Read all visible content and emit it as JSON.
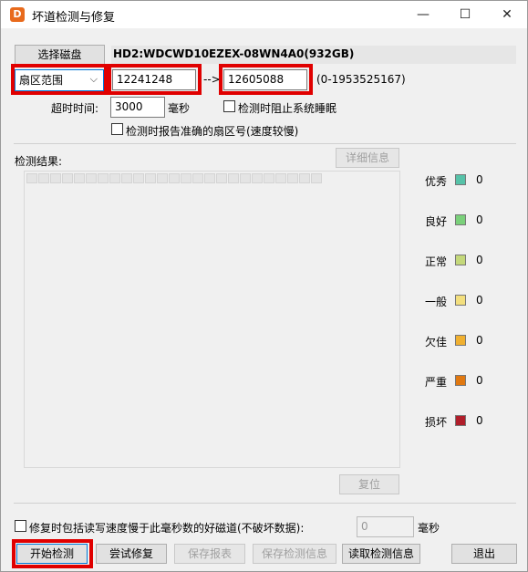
{
  "window": {
    "title": "坏道检测与修复",
    "app_icon_glyph": "D",
    "minimize": "—",
    "maximize": "☐",
    "close": "✕"
  },
  "disk": {
    "select_button": "选择磁盘",
    "name": "HD2:WDCWD10EZEX-08WN4A0(932GB)"
  },
  "range": {
    "mode_selected": "扇区范围",
    "start": "12241248",
    "arrow": "-->",
    "end": "12605088",
    "limit_hint": "(0-1953525167)"
  },
  "timeout": {
    "label": "超时时间:",
    "value": "3000",
    "unit": "毫秒"
  },
  "options": {
    "prevent_sleep": "检测时阻止系统睡眠",
    "report_exact_sector": "检测时报告准确的扇区号(速度较慢)"
  },
  "results": {
    "label": "检测结果:",
    "detail_button": "详细信息",
    "reset_button": "复位",
    "legend": [
      {
        "label": "优秀",
        "count": "0",
        "color": "#56c2a8"
      },
      {
        "label": "良好",
        "count": "0",
        "color": "#7ad07a"
      },
      {
        "label": "正常",
        "count": "0",
        "color": "#c4d87a"
      },
      {
        "label": "一般",
        "count": "0",
        "color": "#f3df7e"
      },
      {
        "label": "欠佳",
        "count": "0",
        "color": "#f0b030"
      },
      {
        "label": "严重",
        "count": "0",
        "color": "#e07810"
      },
      {
        "label": "损坏",
        "count": "0",
        "color": "#b01e2a"
      }
    ]
  },
  "repair_option": {
    "label": "修复时包括读写速度慢于此毫秒数的好磁道(不破坏数据):",
    "value": "0",
    "unit": "毫秒"
  },
  "actions": {
    "start": "开始检测",
    "try_repair": "尝试修复",
    "save_report": "保存报表",
    "save_info": "保存检测信息",
    "load_info": "读取检测信息",
    "exit": "退出"
  },
  "colors": {
    "highlight": "#e00000",
    "accent": "#0078d7"
  }
}
